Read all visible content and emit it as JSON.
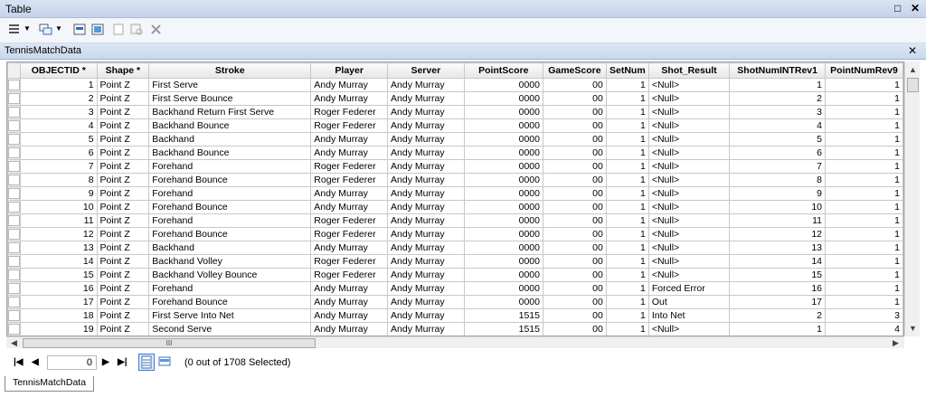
{
  "window": {
    "title": "Table"
  },
  "tab": {
    "name": "TennisMatchData"
  },
  "bottom_tab": {
    "name": "TennisMatchData"
  },
  "columns": [
    "OBJECTID *",
    "Shape *",
    "Stroke",
    "Player",
    "Server",
    "PointScore",
    "GameScore",
    "SetNum",
    "Shot_Result",
    "ShotNumINTRev1",
    "PointNumRev9"
  ],
  "rows": [
    [
      "1",
      "Point Z",
      "First Serve",
      "Andy Murray",
      "Andy Murray",
      "0000",
      "00",
      "1",
      "<Null>",
      "1",
      "1"
    ],
    [
      "2",
      "Point Z",
      "First Serve Bounce",
      "Andy Murray",
      "Andy Murray",
      "0000",
      "00",
      "1",
      "<Null>",
      "2",
      "1"
    ],
    [
      "3",
      "Point Z",
      "Backhand Return First Serve",
      "Roger Federer",
      "Andy Murray",
      "0000",
      "00",
      "1",
      "<Null>",
      "3",
      "1"
    ],
    [
      "4",
      "Point Z",
      "Backhand Bounce",
      "Roger Federer",
      "Andy Murray",
      "0000",
      "00",
      "1",
      "<Null>",
      "4",
      "1"
    ],
    [
      "5",
      "Point Z",
      "Backhand",
      "Andy Murray",
      "Andy Murray",
      "0000",
      "00",
      "1",
      "<Null>",
      "5",
      "1"
    ],
    [
      "6",
      "Point Z",
      "Backhand Bounce",
      "Andy Murray",
      "Andy Murray",
      "0000",
      "00",
      "1",
      "<Null>",
      "6",
      "1"
    ],
    [
      "7",
      "Point Z",
      "Forehand",
      "Roger Federer",
      "Andy Murray",
      "0000",
      "00",
      "1",
      "<Null>",
      "7",
      "1"
    ],
    [
      "8",
      "Point Z",
      "Forehand Bounce",
      "Roger Federer",
      "Andy Murray",
      "0000",
      "00",
      "1",
      "<Null>",
      "8",
      "1"
    ],
    [
      "9",
      "Point Z",
      "Forehand",
      "Andy Murray",
      "Andy Murray",
      "0000",
      "00",
      "1",
      "<Null>",
      "9",
      "1"
    ],
    [
      "10",
      "Point Z",
      "Forehand Bounce",
      "Andy Murray",
      "Andy Murray",
      "0000",
      "00",
      "1",
      "<Null>",
      "10",
      "1"
    ],
    [
      "11",
      "Point Z",
      "Forehand",
      "Roger Federer",
      "Andy Murray",
      "0000",
      "00",
      "1",
      "<Null>",
      "11",
      "1"
    ],
    [
      "12",
      "Point Z",
      "Forehand Bounce",
      "Roger Federer",
      "Andy Murray",
      "0000",
      "00",
      "1",
      "<Null>",
      "12",
      "1"
    ],
    [
      "13",
      "Point Z",
      "Backhand",
      "Andy Murray",
      "Andy Murray",
      "0000",
      "00",
      "1",
      "<Null>",
      "13",
      "1"
    ],
    [
      "14",
      "Point Z",
      "Backhand Volley",
      "Roger Federer",
      "Andy Murray",
      "0000",
      "00",
      "1",
      "<Null>",
      "14",
      "1"
    ],
    [
      "15",
      "Point Z",
      "Backhand Volley Bounce",
      "Roger Federer",
      "Andy Murray",
      "0000",
      "00",
      "1",
      "<Null>",
      "15",
      "1"
    ],
    [
      "16",
      "Point Z",
      "Forehand",
      "Andy Murray",
      "Andy Murray",
      "0000",
      "00",
      "1",
      "Forced Error",
      "16",
      "1"
    ],
    [
      "17",
      "Point Z",
      "Forehand Bounce",
      "Andy Murray",
      "Andy Murray",
      "0000",
      "00",
      "1",
      "Out",
      "17",
      "1"
    ],
    [
      "18",
      "Point Z",
      "First Serve Into Net",
      "Andy Murray",
      "Andy Murray",
      "1515",
      "00",
      "1",
      "Into Net",
      "2",
      "3"
    ],
    [
      "19",
      "Point Z",
      "Second Serve",
      "Andy Murray",
      "Andy Murray",
      "1515",
      "00",
      "1",
      "<Null>",
      "1",
      "4"
    ]
  ],
  "navigation": {
    "current_record": "0",
    "status": "(0 out of 1708 Selected)"
  },
  "scrollbar": {
    "thumb_grip": "III"
  },
  "icons": {
    "table_options": "table-options-icon",
    "related_tables": "related-tables-icon",
    "select_by_attributes": "select-by-attributes-icon",
    "switch_selection": "switch-selection-icon",
    "clear_selection": "clear-selection-icon",
    "zoom_to_selected": "zoom-to-selected-icon",
    "delete_selected": "delete-selected-icon"
  },
  "colors": {
    "titlebar": "#c3d3ea",
    "tabbar": "#c9d8ee",
    "grid_border": "#c8c8c8"
  }
}
